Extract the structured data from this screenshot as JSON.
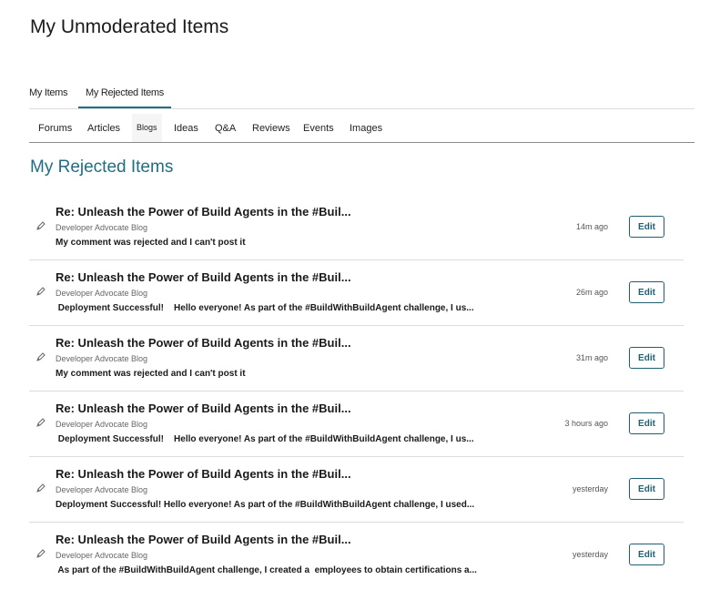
{
  "page": {
    "title": "My Unmoderated Items"
  },
  "main_tabs": [
    {
      "label": "My Items"
    },
    {
      "label": "My Rejected Items",
      "active": true
    }
  ],
  "sub_tabs": [
    {
      "label": "Forums"
    },
    {
      "label": "Articles"
    },
    {
      "label": "Blogs",
      "active": true
    },
    {
      "label": "Ideas"
    },
    {
      "label": "Q&A"
    },
    {
      "label": "Reviews"
    },
    {
      "label": "Events"
    },
    {
      "label": "Images"
    }
  ],
  "section": {
    "title": "My Rejected Items"
  },
  "edit_label": "Edit",
  "items": [
    {
      "title": "Re: Unleash the Power of Build Agents in the #Buil...",
      "source": "Developer Advocate Blog",
      "body": "My comment was rejected and I can't post it",
      "time": "14m ago",
      "icon": "edit-pen-icon"
    },
    {
      "title": "Re: Unleash the Power of Build Agents in the #Buil...",
      "source": "Developer Advocate Blog",
      "body": " Deployment Successful!    Hello everyone! As part of the #BuildWithBuildAgent challenge, I us...",
      "time": "26m ago",
      "icon": "edit-pen-icon"
    },
    {
      "title": "Re: Unleash the Power of Build Agents in the #Buil...",
      "source": "Developer Advocate Blog",
      "body": "My comment was rejected and I can't post it",
      "time": "31m ago",
      "icon": "edit-pen-icon"
    },
    {
      "title": "Re: Unleash the Power of Build Agents in the #Buil...",
      "source": "Developer Advocate Blog",
      "body": " Deployment Successful!    Hello everyone! As part of the #BuildWithBuildAgent challenge, I us...",
      "time": "3 hours ago",
      "icon": "edit-pen-icon"
    },
    {
      "title": "Re: Unleash the Power of Build Agents in the #Buil...",
      "source": "Developer Advocate Blog",
      "body": "Deployment Successful! Hello everyone! As part of the #BuildWithBuildAgent challenge, I used...",
      "time": "yesterday",
      "icon": "edit-pen-icon"
    },
    {
      "title": "Re: Unleash the Power of Build Agents in the #Buil...",
      "source": "Developer Advocate Blog",
      "body": " As part of the #BuildWithBuildAgent challenge, I created a  employees to obtain certifications a...",
      "time": "yesterday",
      "icon": "edit-pen-icon"
    }
  ]
}
